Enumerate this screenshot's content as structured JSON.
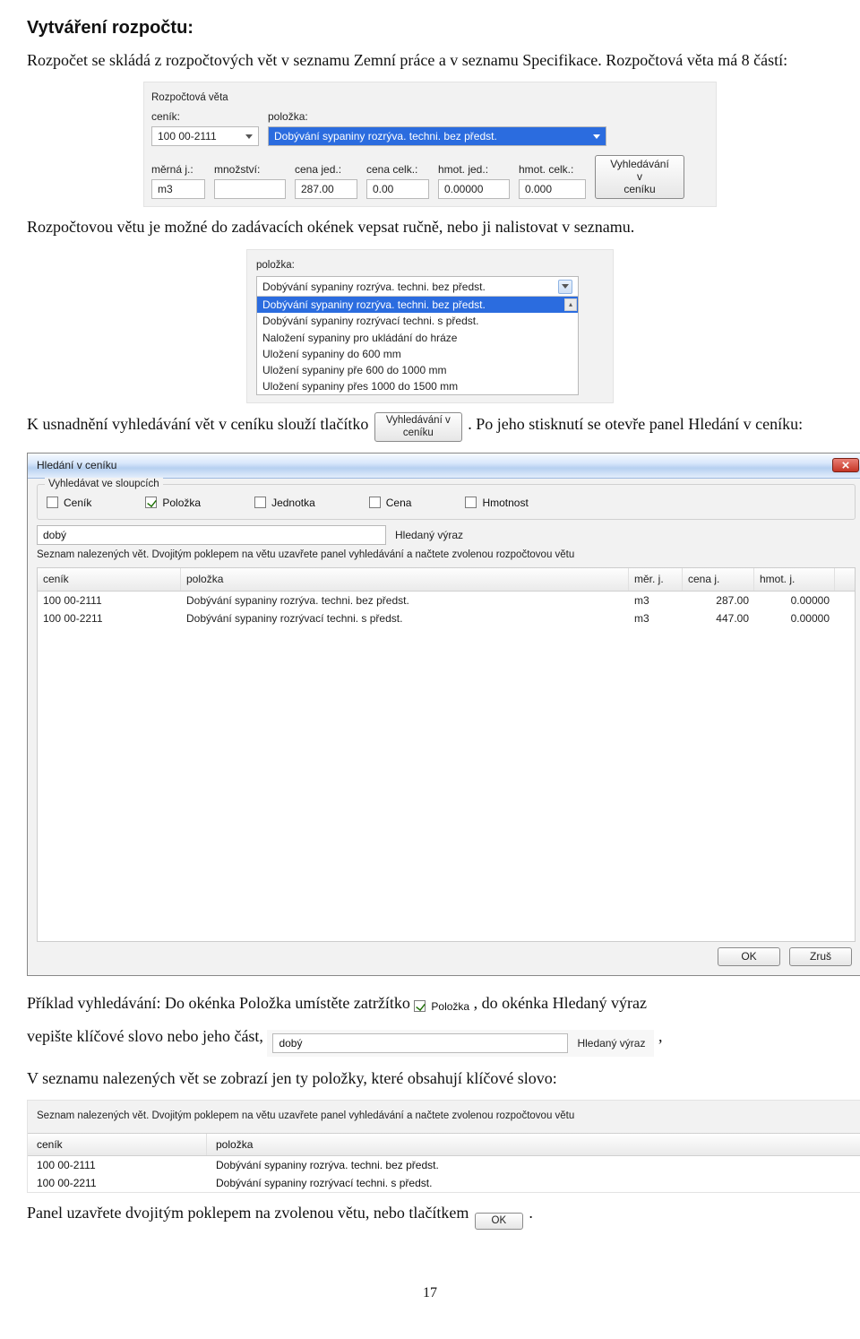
{
  "heading": "Vytváření rozpočtu:",
  "para1": "Rozpočet se skládá z rozpočtových vět v seznamu Zemní práce a v seznamu Specifikace. Rozpočtová věta má 8 částí:",
  "para2": "Rozpočtovou větu je možné do zadávacích okének vepsat ručně, nebo ji nalistovat v seznamu.",
  "sentence1a": "K usnadnění vyhledávání vět v ceníku slouží tlačítko ",
  "sentence1b": ". Po jeho stisknutí se otevře panel Hledání v ceníku:",
  "sentence2a": "Příklad vyhledávání: Do okénka Položka umístěte zatržítko ",
  "sentence2b": ", do okénka Hledaný výraz",
  "sentence3a": "vepište klíčové slovo nebo jeho část, ",
  "sentence3b": ",",
  "sentence4": "V seznamu nalezených vět se zobrazí jen ty položky, které obsahují klíčové slovo:",
  "sentence5": "Panel uzavřete dvojitým poklepem na zvolenou větu, nebo tlačítkem ",
  "sentence5b": ".",
  "page_number": "17",
  "btn_search_label": "Vyhledávání v\nceníku",
  "btn_ok": "OK",
  "btn_cancel": "Zruš",
  "panel1": {
    "title": "Rozpočtová věta",
    "labels": {
      "cenik": "ceník:",
      "polozka": "položka:",
      "merna": "měrná j.:",
      "mnozstvi": "množství:",
      "cenajed": "cena jed.:",
      "cenacelk": "cena celk.:",
      "hmotjed": "hmot. jed.:",
      "hmotcelk": "hmot. celk.:"
    },
    "values": {
      "cenik": "100 00-2111",
      "polozka": "Dobývání sypaniny rozrýva. techni. bez předst.",
      "merna": "m3",
      "mnozstvi": "",
      "cenajed": "287.00",
      "cenacelk": "0.00",
      "hmotjed": "0.00000",
      "hmotcelk": "0.000"
    }
  },
  "drop": {
    "label": "položka:",
    "trigger": "Dobývání sypaniny rozrýva. techni. bez předst.",
    "items": [
      "Dobývání sypaniny rozrýva. techni. bez předst.",
      "Dobývání sypaniny rozrývací techni. s předst.",
      "Naložení sypaniny pro ukládání do hráze",
      "Uložení sypaniny do 600 mm",
      "Uložení sypaniny pře 600 do 1000 mm",
      "Uložení sypaniny přes 1000 do 1500 mm"
    ],
    "selected_index": 0
  },
  "dialog": {
    "title": "Hledání v ceníku",
    "group_label": "Vyhledávat ve sloupcích",
    "checks": [
      {
        "label": "Ceník",
        "on": false
      },
      {
        "label": "Položka",
        "on": true
      },
      {
        "label": "Jednotka",
        "on": false
      },
      {
        "label": "Cena",
        "on": false
      },
      {
        "label": "Hmotnost",
        "on": false
      }
    ],
    "search_value": "dobý",
    "search_label": "Hledaný výraz",
    "hint": "Seznam nalezených vět. Dvojitým poklepem na větu uzavřete panel vyhledávání a načtete zvolenou rozpočtovou větu",
    "headers": {
      "cenik": "ceník",
      "polozka": "položka",
      "merj": "měr. j.",
      "cenaj": "cena j.",
      "hmotj": "hmot. j."
    },
    "rows": [
      {
        "cenik": "100 00-2111",
        "polozka": "Dobývání sypaniny rozrýva. techni. bez předst.",
        "merj": "m3",
        "cenaj": "287.00",
        "hmotj": "0.00000"
      },
      {
        "cenik": "100 00-2211",
        "polozka": "Dobývání sypaniny rozrývací techni. s předst.",
        "merj": "m3",
        "cenaj": "447.00",
        "hmotj": "0.00000"
      }
    ]
  },
  "chip_polozka": "Položka",
  "chip_expr_value": "dobý",
  "chip_expr_label": "Hledaný výraz",
  "results_panel": {
    "hint": "Seznam nalezených vět. Dvojitým poklepem na větu uzavřete panel vyhledávání a načtete zvolenou rozpočtovou větu",
    "headers": {
      "cenik": "ceník",
      "polozka": "položka"
    },
    "rows": [
      {
        "cenik": "100 00-2111",
        "polozka": "Dobývání sypaniny rozrýva. techni. bez předst."
      },
      {
        "cenik": "100 00-2211",
        "polozka": "Dobývání sypaniny rozrývací techni. s předst."
      }
    ]
  }
}
